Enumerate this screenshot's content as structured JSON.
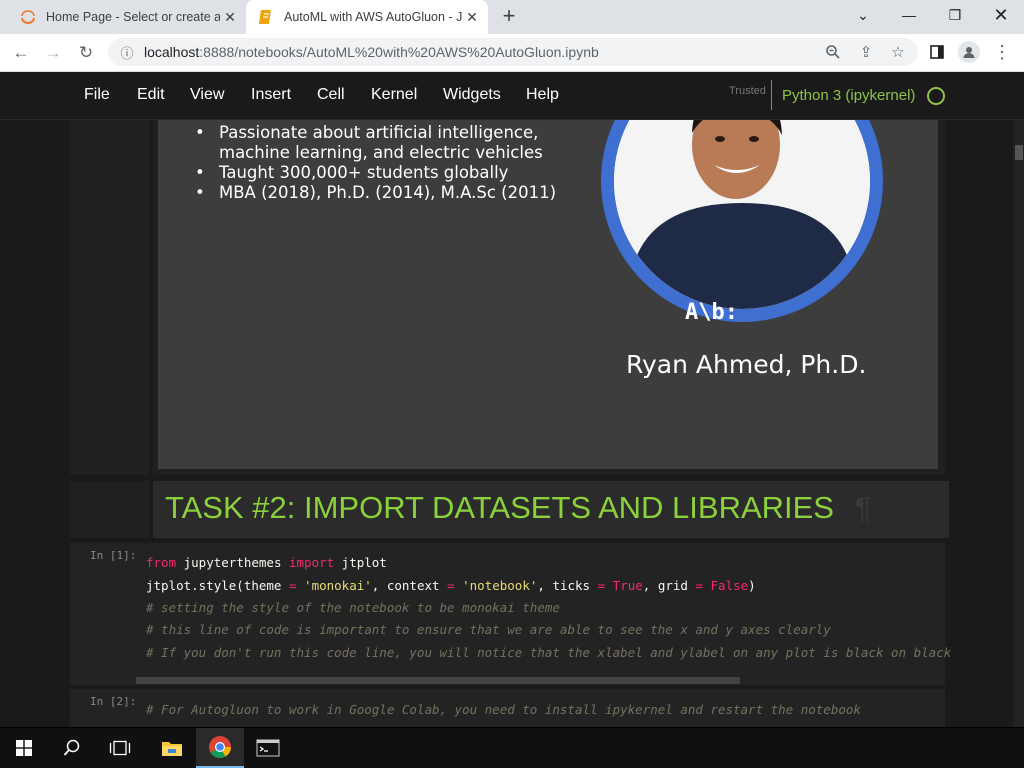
{
  "browser": {
    "tabs": [
      {
        "title": "Home Page - Select or create a n",
        "icon": "jupyter-logo-icon"
      },
      {
        "title": "AutoML with AWS AutoGluon - Ju",
        "icon": "notebook-icon"
      }
    ],
    "url_host": "localhost",
    "url_rest": ":8888/notebooks/AutoML%20with%20AWS%20AutoGluon.ipynb"
  },
  "menubar": {
    "items": [
      "File",
      "Edit",
      "View",
      "Insert",
      "Cell",
      "Kernel",
      "Widgets",
      "Help"
    ],
    "trusted": "Trusted",
    "kernel": "Python 3 (ipykernel)"
  },
  "slide": {
    "bullets": [
      "Passionate about artificial intelligence,",
      "machine learning, and electric vehicles",
      "Taught 300,000+ students globally",
      "MBA (2018), Ph.D. (2014), M.A.Sc (2011)"
    ],
    "shirt_text": "A\\b:",
    "name": "Ryan Ahmed, Ph.D."
  },
  "task_header": "TASK #2: IMPORT DATASETS AND LIBRARIES",
  "pilcrow": "¶",
  "cells": [
    {
      "prompt": "In [1]:"
    },
    {
      "prompt": "In [2]:"
    }
  ],
  "code1": {
    "l1_kw1": "from",
    "l1_mod": " jupyterthemes ",
    "l1_kw2": "import",
    "l1_name": " jtplot",
    "l2_a": "jtplot.style(theme ",
    "l2_eq1": "=",
    "l2_s1": " 'monokai'",
    "l2_b": ", context ",
    "l2_eq2": "=",
    "l2_s2": " 'notebook'",
    "l2_c": ", ticks ",
    "l2_eq3": "=",
    "l2_t": " True",
    "l2_d": ", grid ",
    "l2_eq4": "=",
    "l2_f": " False",
    "l2_e": ")",
    "l3": "# setting the style of the notebook to be monokai theme",
    "l4": "# this line of code is important to ensure that we are able to see the x and y axes clearly",
    "l5": "# If you don't run this code line, you will notice that the xlabel and ylabel on any plot is black on black"
  },
  "code2": {
    "l1": "# For Autogluon to work in Google Colab, you need to install ipykernel and restart the notebook"
  },
  "colors": {
    "accent_green": "#8bd13c",
    "ring_blue": "#3f6fd0",
    "menubar_bg": "#1a1a1a"
  }
}
